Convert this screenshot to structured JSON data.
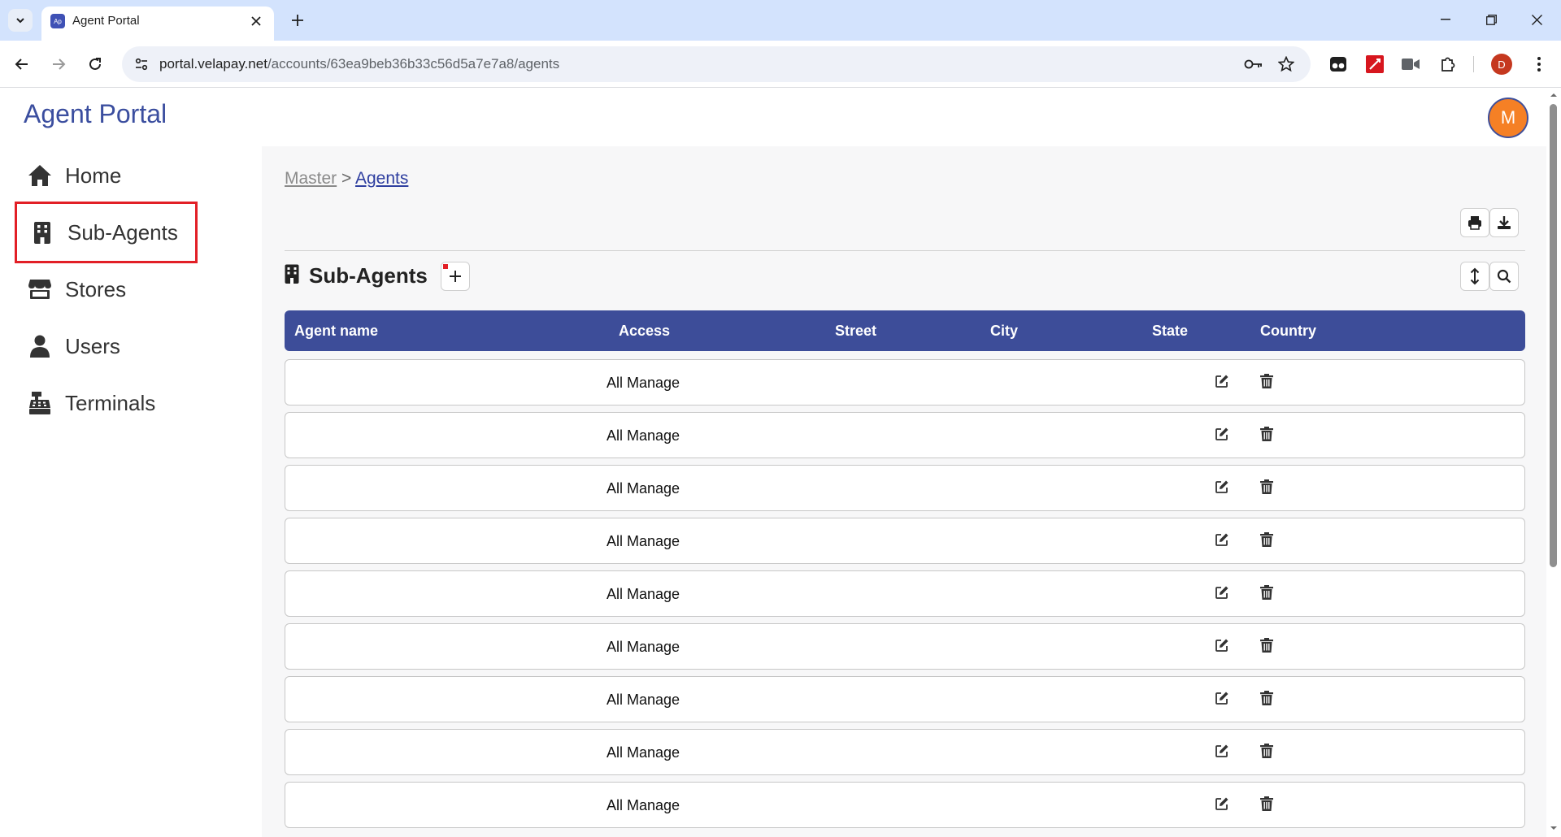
{
  "browser": {
    "tab_title": "Agent Portal",
    "favicon_text": "Ap",
    "url_host": "portal.velapay.net",
    "url_path": "/accounts/63ea9beb36b33c56d5a7e7a8/agents",
    "profile_initial": "D"
  },
  "app": {
    "title": "Agent Portal",
    "avatar_initial": "M"
  },
  "sidebar": {
    "items": [
      {
        "label": "Home",
        "icon": "home-icon"
      },
      {
        "label": "Sub-Agents",
        "icon": "building-icon",
        "highlighted": true
      },
      {
        "label": "Stores",
        "icon": "store-icon"
      },
      {
        "label": "Users",
        "icon": "user-icon"
      },
      {
        "label": "Terminals",
        "icon": "cash-register-icon"
      }
    ]
  },
  "breadcrumb": {
    "master": "Master",
    "separator": ">",
    "current": "Agents"
  },
  "section": {
    "title": "Sub-Agents"
  },
  "table": {
    "columns": [
      "Agent name",
      "Access",
      "Street",
      "City",
      "State",
      "Country"
    ],
    "rows": [
      {
        "agent_name": "",
        "access": "All Manage",
        "street": "",
        "city": "",
        "state": "",
        "country": ""
      },
      {
        "agent_name": "",
        "access": "All Manage",
        "street": "",
        "city": "",
        "state": "",
        "country": ""
      },
      {
        "agent_name": "",
        "access": "All Manage",
        "street": "",
        "city": "",
        "state": "",
        "country": ""
      },
      {
        "agent_name": "",
        "access": "All Manage",
        "street": "",
        "city": "",
        "state": "",
        "country": ""
      },
      {
        "agent_name": "",
        "access": "All Manage",
        "street": "",
        "city": "",
        "state": "",
        "country": ""
      },
      {
        "agent_name": "",
        "access": "All Manage",
        "street": "",
        "city": "",
        "state": "",
        "country": ""
      },
      {
        "agent_name": "",
        "access": "All Manage",
        "street": "",
        "city": "",
        "state": "",
        "country": ""
      },
      {
        "agent_name": "",
        "access": "All Manage",
        "street": "",
        "city": "",
        "state": "",
        "country": ""
      },
      {
        "agent_name": "",
        "access": "All Manage",
        "street": "",
        "city": "",
        "state": "",
        "country": ""
      }
    ]
  },
  "colors": {
    "accent": "#3d4d99",
    "title": "#3b4e9f",
    "highlight": "#e21f26",
    "avatar": "#f58025"
  }
}
